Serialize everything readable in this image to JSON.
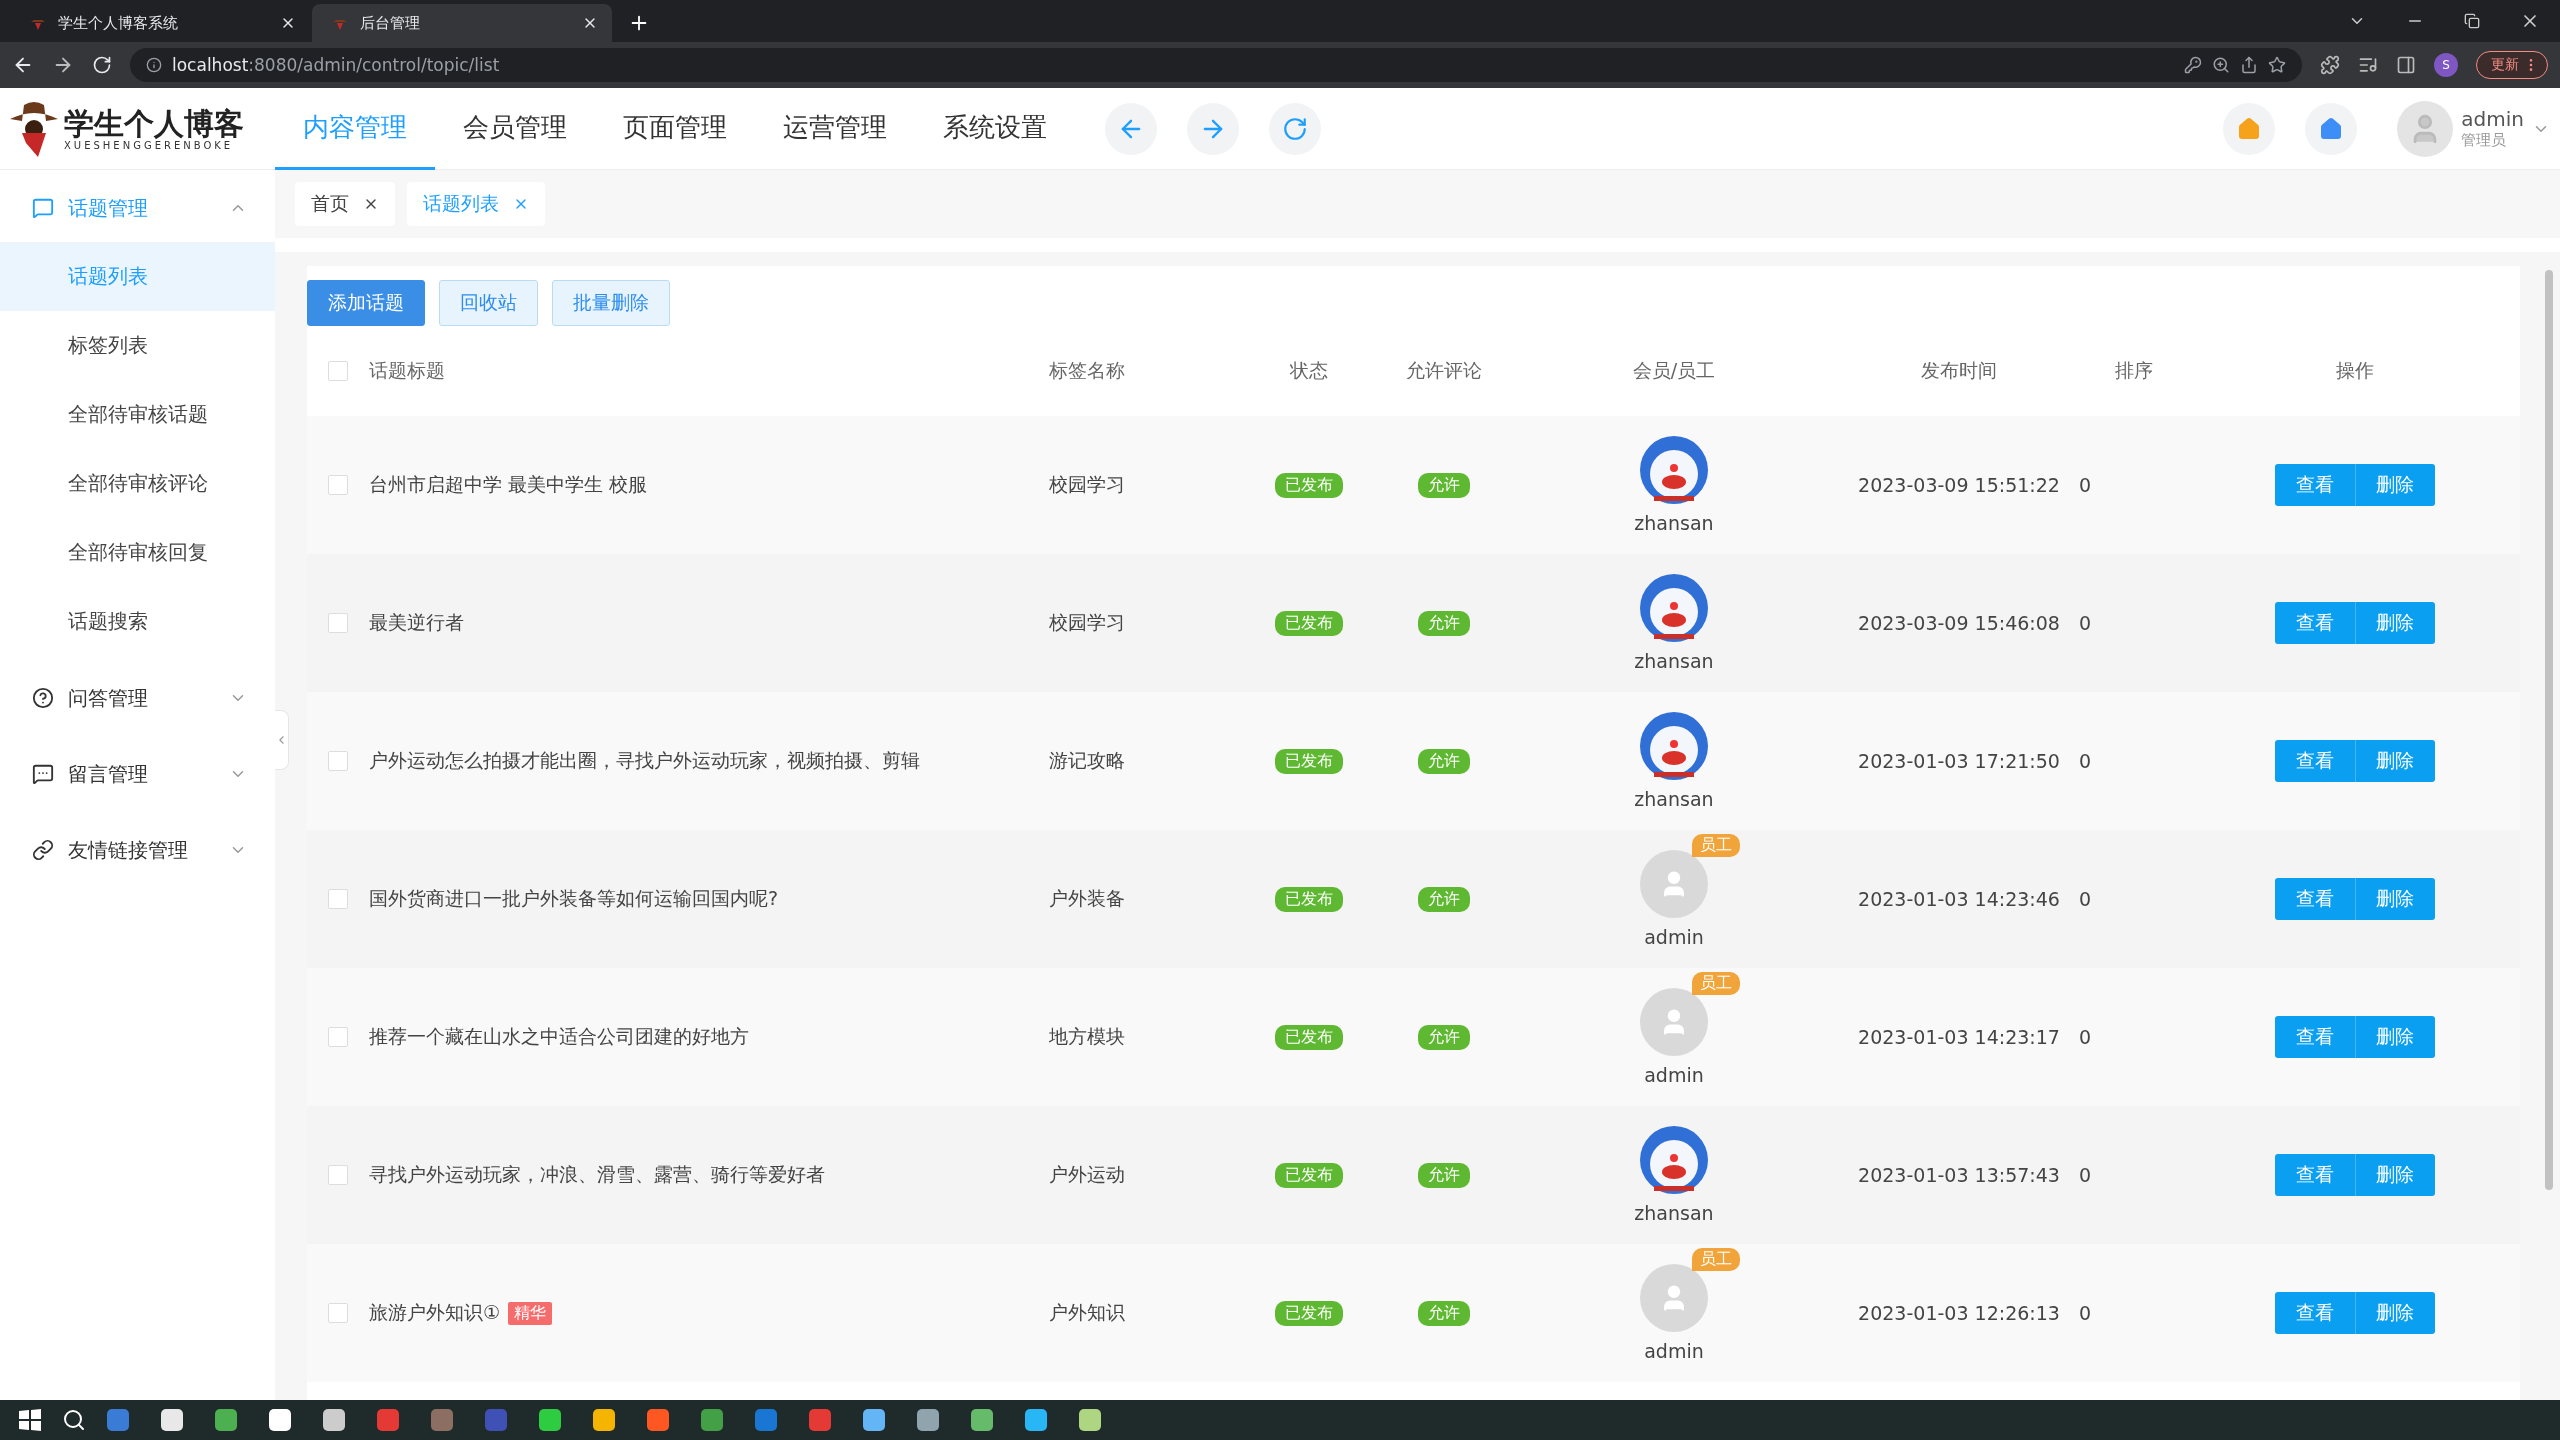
{
  "browser": {
    "tabs": [
      {
        "title": "学生个人博客系统",
        "selected": false
      },
      {
        "title": "后台管理",
        "selected": true
      }
    ],
    "url": {
      "host": "localhost",
      "path": ":8080/admin/control/topic/list"
    },
    "profile_initial": "S",
    "update_button": "更新"
  },
  "header": {
    "logo": {
      "title": "学生个人博客",
      "subtitle": "XUESHENGGERENBOKE"
    },
    "nav": [
      {
        "label": "内容管理",
        "selected": true
      },
      {
        "label": "会员管理",
        "selected": false
      },
      {
        "label": "页面管理",
        "selected": false
      },
      {
        "label": "运营管理",
        "selected": false
      },
      {
        "label": "系统设置",
        "selected": false
      }
    ],
    "user": {
      "name": "admin",
      "role": "管理员"
    }
  },
  "sidebar": [
    {
      "label": "话题管理",
      "kind": "topic",
      "expanded": true,
      "children": [
        {
          "label": "话题列表",
          "selected": true
        },
        {
          "label": "标签列表",
          "selected": false
        },
        {
          "label": "全部待审核话题",
          "selected": false
        },
        {
          "label": "全部待审核评论",
          "selected": false
        },
        {
          "label": "全部待审核回复",
          "selected": false
        },
        {
          "label": "话题搜索",
          "selected": false
        }
      ]
    },
    {
      "label": "问答管理",
      "kind": "qa",
      "expanded": false
    },
    {
      "label": "留言管理",
      "kind": "message",
      "expanded": false
    },
    {
      "label": "友情链接管理",
      "kind": "link",
      "expanded": false
    }
  ],
  "page_tabs": [
    {
      "label": "首页",
      "selected": false
    },
    {
      "label": "话题列表",
      "selected": true
    }
  ],
  "toolbar": [
    {
      "label": "添加话题",
      "kind": "primary"
    },
    {
      "label": "回收站",
      "kind": "plain"
    },
    {
      "label": "批量删除",
      "kind": "plain"
    }
  ],
  "table": {
    "header_checked": false,
    "columns": [
      "话题标题",
      "标签名称",
      "状态",
      "允许评论",
      "会员/员工",
      "发布时间",
      "排序",
      "操作"
    ],
    "rows": [
      {
        "checked": false,
        "title": "台州市启超中学 最美中学生 校服",
        "tag": "校园学习",
        "status": "已发布",
        "comment": "允许",
        "member": {
          "name": "zhansan",
          "kind": "picture"
        },
        "time": "2023-03-09 15:51:22",
        "sort": "0",
        "actions": [
          "查看",
          "删除"
        ]
      },
      {
        "checked": false,
        "title": "最美逆行者",
        "tag": "校园学习",
        "status": "已发布",
        "comment": "允许",
        "member": {
          "name": "zhansan",
          "kind": "picture"
        },
        "time": "2023-03-09 15:46:08",
        "sort": "0",
        "actions": [
          "查看",
          "删除"
        ]
      },
      {
        "checked": false,
        "title": "户外运动怎么拍摄才能出圈，寻找户外运动玩家，视频拍摄、剪辑",
        "tag": "游记攻略",
        "status": "已发布",
        "comment": "允许",
        "member": {
          "name": "zhansan",
          "kind": "picture"
        },
        "time": "2023-01-03 17:21:50",
        "sort": "0",
        "actions": [
          "查看",
          "删除"
        ]
      },
      {
        "checked": false,
        "title": "国外货商进口一批户外装备等如何运输回国内呢?",
        "tag": "户外装备",
        "status": "已发布",
        "comment": "允许",
        "member": {
          "name": "admin",
          "kind": "default",
          "badge": "员工"
        },
        "time": "2023-01-03 14:23:46",
        "sort": "0",
        "actions": [
          "查看",
          "删除"
        ]
      },
      {
        "checked": false,
        "title": "推荐一个藏在山水之中适合公司团建的好地方",
        "tag": "地方模块",
        "status": "已发布",
        "comment": "允许",
        "member": {
          "name": "admin",
          "kind": "default",
          "badge": "员工"
        },
        "time": "2023-01-03 14:23:17",
        "sort": "0",
        "actions": [
          "查看",
          "删除"
        ]
      },
      {
        "checked": false,
        "title": "寻找户外运动玩家，冲浪、滑雪、露营、骑行等爱好者",
        "tag": "户外运动",
        "status": "已发布",
        "comment": "允许",
        "member": {
          "name": "zhansan",
          "kind": "picture"
        },
        "time": "2023-01-03 13:57:43",
        "sort": "0",
        "actions": [
          "查看",
          "删除"
        ]
      },
      {
        "checked": false,
        "title": "旅游户外知识①",
        "highlight": "精华",
        "tag": "户外知识",
        "status": "已发布",
        "comment": "允许",
        "member": {
          "name": "admin",
          "kind": "default",
          "badge": "员工"
        },
        "time": "2023-01-03 12:26:13",
        "sort": "0",
        "actions": [
          "查看",
          "删除"
        ]
      }
    ]
  }
}
